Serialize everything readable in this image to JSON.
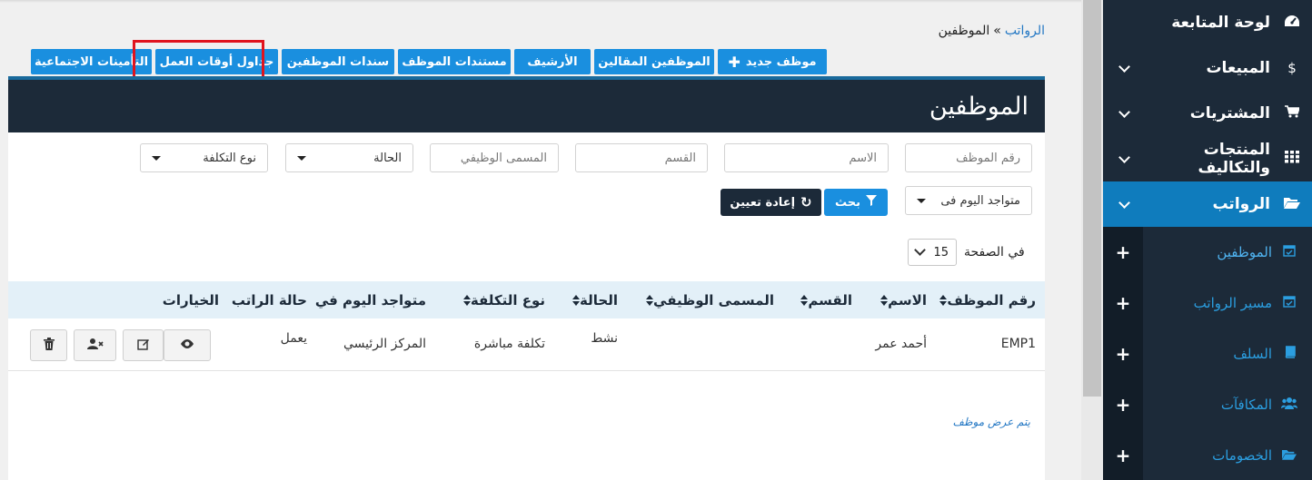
{
  "breadcrumb": {
    "link": "الرواتب",
    "separator": "»",
    "current": "الموظفين"
  },
  "actions": [
    {
      "label": "موظف جديد",
      "icon": "plus-icon"
    },
    {
      "label": "الموظفين المقالين"
    },
    {
      "label": "الأرشيف"
    },
    {
      "label": "مستندات الموظف"
    },
    {
      "label": "سندات الموظفين"
    },
    {
      "label": "جداول أوقات العمل"
    },
    {
      "label": "التأمينات الاجتماعية"
    }
  ],
  "panel": {
    "title": "الموظفين"
  },
  "filters": {
    "emp_no": "رقم الموظف",
    "name": "الاسم",
    "dept": "القسم",
    "job_title": "المسمى الوظيفي",
    "status": "الحالة",
    "cost_type": "نوع التكلفة",
    "present_today": "متواجد اليوم فى",
    "search_label": "بحث",
    "reset_label": "إعادة تعيين"
  },
  "pagination": {
    "per_page_label": "في الصفحة",
    "per_page_value": "15"
  },
  "table": {
    "headers": [
      "رقم الموظف",
      "الاسم",
      "القسم",
      "المسمى الوظيفي",
      "الحالة",
      "نوع التكلفة",
      "متواجد اليوم في",
      "حالة الراتب",
      "الخيارات"
    ],
    "rows": [
      {
        "emp_no": "EMP1",
        "name": "أحمد عمر",
        "dept": "",
        "job_title": "",
        "status": "نشط",
        "cost_type": "تكلفة مباشرة",
        "present_today": "المركز الرئيسي",
        "salary_status": "يعمل"
      }
    ]
  },
  "footer_note": "يتم عرض موظف",
  "sidebar": {
    "items": [
      {
        "label": "لوحة المتابعة",
        "icon": "dashboard-icon"
      },
      {
        "label": "المبيعات",
        "icon": "dollar-icon"
      },
      {
        "label": "المشتريات",
        "icon": "cart-icon"
      },
      {
        "label": "المنتجات والتكاليف",
        "icon": "grid-icon"
      },
      {
        "label": "الرواتب",
        "icon": "folder-open-icon"
      }
    ],
    "sub_items": [
      {
        "label": "الموظفين",
        "icon": "calendar-check-icon"
      },
      {
        "label": "مسير الرواتب",
        "icon": "calendar-check-icon"
      },
      {
        "label": "السلف",
        "icon": "book-icon"
      },
      {
        "label": "المكافآت",
        "icon": "users-icon"
      },
      {
        "label": "الخصومات",
        "icon": "folder-open-icon"
      }
    ]
  },
  "colors": {
    "accent": "#1a8fdf",
    "sidebar": "#1c2a39",
    "active": "#0f7cbd",
    "highlight": "#e0141e"
  }
}
